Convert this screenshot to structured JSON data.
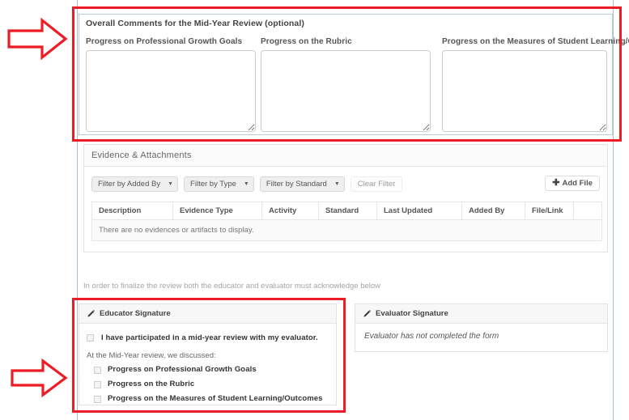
{
  "overall_comments": {
    "title": "Overall Comments for the Mid-Year Review (optional)",
    "columns": [
      {
        "label": "Progress on Professional Growth Goals",
        "value": "",
        "placeholder": ""
      },
      {
        "label": "Progress on the Rubric",
        "value": "",
        "placeholder": ""
      },
      {
        "label": "Progress on the Measures of Student Learning/Outcomes",
        "value": "",
        "placeholder": ""
      }
    ]
  },
  "evidence": {
    "header": "Evidence & Attachments",
    "filters": [
      {
        "label": "Filter by Added By"
      },
      {
        "label": "Filter by Type"
      },
      {
        "label": "Filter by Standard"
      }
    ],
    "clear_filter_label": "Clear Filter",
    "add_file_label": "Add File",
    "add_file_icon": "plus-icon",
    "table": {
      "headers": [
        "Description",
        "Evidence Type",
        "Activity",
        "Standard",
        "Last Updated",
        "Added By",
        "File/Link",
        ""
      ],
      "empty_message": "There are no evidences or artifacts to display."
    }
  },
  "finalize_note": "In order to finalize the review both the educator and evaluator must acknowledge below",
  "educator_signature": {
    "header": "Educator Signature",
    "header_icon": "pencil-icon",
    "acknowledgement": "I have participated in a mid-year review with my evaluator.",
    "acknowledgement_checked": false,
    "discussed_label": "At the Mid-Year review, we discussed:",
    "topics": [
      {
        "label": "Progress on Professional Growth Goals",
        "checked": false
      },
      {
        "label": "Progress on the Rubric",
        "checked": false
      },
      {
        "label": "Progress on the Measures of Student Learning/Outcomes",
        "checked": false
      }
    ]
  },
  "evaluator_signature": {
    "header": "Evaluator Signature",
    "header_icon": "pencil-icon",
    "status_text": "Evaluator has not completed the form"
  },
  "annotations": {
    "highlight_color": "#ee1c25",
    "arrow_icon": "right-arrow-icon",
    "boxes": [
      "overall-comments-highlight",
      "educator-signature-highlight"
    ]
  }
}
